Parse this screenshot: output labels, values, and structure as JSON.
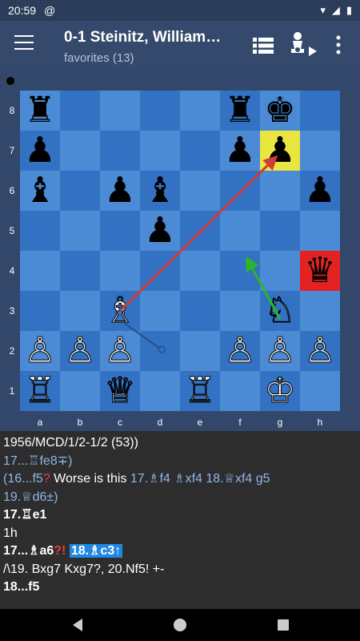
{
  "status": {
    "time": "20:59",
    "sync_glyph": "@",
    "wifi_glyph": "▾",
    "signal_glyph": "◢",
    "battery_glyph": "▮"
  },
  "appbar": {
    "title": "0-1 Steinitz, William…",
    "subtitle": "favorites (13)",
    "icons": [
      "menu-icon",
      "list-icon",
      "engine-icon",
      "more-vert-icon"
    ]
  },
  "board": {
    "side_to_move": "black",
    "ranks": [
      "8",
      "7",
      "6",
      "5",
      "4",
      "3",
      "2",
      "1"
    ],
    "files": [
      "a",
      "b",
      "c",
      "d",
      "e",
      "f",
      "g",
      "h"
    ],
    "highlights": {
      "g7": "yellow",
      "h4": "red"
    },
    "pieces": {
      "a8": "♜",
      "f8": "♜",
      "g8": "♚",
      "a7": "♟",
      "f7": "♟",
      "g7": "♟",
      "a6": "♝",
      "c6": "♟",
      "d6": "♝",
      "h6": "♟",
      "d5": "♟",
      "h4": "♛",
      "c3": "♗",
      "g3": "♘",
      "a2": "♙",
      "b2": "♙",
      "c2": "♙",
      "f2": "♙",
      "g2": "♙",
      "h2": "♙",
      "a1": "♖",
      "c1": "♕",
      "e1": "♖",
      "g1": "♔"
    },
    "arrows_colors": {
      "red": "#d23a3a",
      "green": "#2bb52b",
      "dark": "#2b4f85"
    }
  },
  "notation": {
    "l1": " 1956/MCD/1/2-1/2 (53))",
    "l2": "17...♖fe8∓)",
    "l3a": "(16...f5",
    "l3q": "?",
    "l3b": " Worse is this ",
    "l3c": "17.♗f4 ♗xf4 18.♕xf4 g5",
    "l4": "19.♕d6±)",
    "l5": "17.♖e1",
    "l6": "1h",
    "l7a": "17...♗a6",
    "l7q": "?!",
    "l7c": "18.♗c3↑",
    "l8": " /\\19. Bxg7 Kxg7?, 20.Nf5! +-",
    "l9": "18...f5"
  },
  "navbar": {
    "back_glyph": "◀",
    "home_glyph": "●",
    "recent_glyph": "■"
  }
}
